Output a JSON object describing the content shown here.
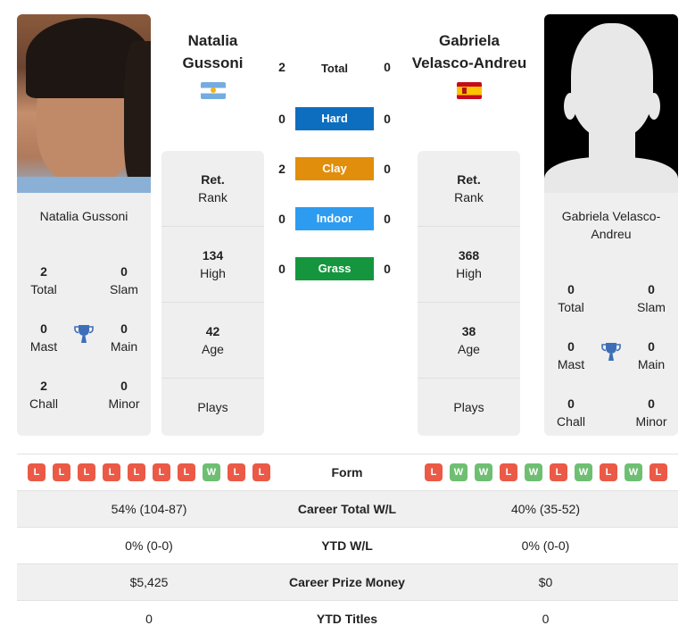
{
  "player1": {
    "name_line1": "Natalia",
    "name_line2": "Gussoni",
    "card_name": "Natalia Gussoni",
    "flag": "argentina-flag",
    "titles": {
      "total": {
        "value": "2",
        "label": "Total"
      },
      "slam": {
        "value": "0",
        "label": "Slam"
      },
      "mast": {
        "value": "0",
        "label": "Mast"
      },
      "main": {
        "value": "0",
        "label": "Main"
      },
      "chall": {
        "value": "2",
        "label": "Chall"
      },
      "minor": {
        "value": "0",
        "label": "Minor"
      }
    },
    "rank": {
      "current": {
        "value": "Ret.",
        "label": "Rank"
      },
      "high": {
        "value": "134",
        "label": "High"
      },
      "age": {
        "value": "42",
        "label": "Age"
      },
      "plays": {
        "label": "Plays"
      }
    },
    "form": [
      "L",
      "L",
      "L",
      "L",
      "L",
      "L",
      "L",
      "W",
      "L",
      "L"
    ],
    "career_wl": "54% (104-87)",
    "ytd_wl": "0% (0-0)",
    "prize_money": "$5,425",
    "ytd_titles": "0"
  },
  "player2": {
    "name_line1": "Gabriela",
    "name_line2": "Velasco-Andreu",
    "card_name_line1": "Gabriela Velasco-",
    "card_name_line2": "Andreu",
    "flag": "spain-flag",
    "titles": {
      "total": {
        "value": "0",
        "label": "Total"
      },
      "slam": {
        "value": "0",
        "label": "Slam"
      },
      "mast": {
        "value": "0",
        "label": "Mast"
      },
      "main": {
        "value": "0",
        "label": "Main"
      },
      "chall": {
        "value": "0",
        "label": "Chall"
      },
      "minor": {
        "value": "0",
        "label": "Minor"
      }
    },
    "rank": {
      "current": {
        "value": "Ret.",
        "label": "Rank"
      },
      "high": {
        "value": "368",
        "label": "High"
      },
      "age": {
        "value": "38",
        "label": "Age"
      },
      "plays": {
        "label": "Plays"
      }
    },
    "form": [
      "L",
      "W",
      "W",
      "L",
      "W",
      "L",
      "W",
      "L",
      "W",
      "L"
    ],
    "career_wl": "40% (35-52)",
    "ytd_wl": "0% (0-0)",
    "prize_money": "$0",
    "ytd_titles": "0"
  },
  "h2h": {
    "total": {
      "label": "Total",
      "p1": "2",
      "p2": "0"
    },
    "surfaces": [
      {
        "label": "Hard",
        "p1": "0",
        "p2": "0",
        "color": "#0d6ebf"
      },
      {
        "label": "Clay",
        "p1": "2",
        "p2": "0",
        "color": "#e08e0b"
      },
      {
        "label": "Indoor",
        "p1": "0",
        "p2": "0",
        "color": "#2d9cf0"
      },
      {
        "label": "Grass",
        "p1": "0",
        "p2": "0",
        "color": "#15963e"
      }
    ]
  },
  "table": {
    "form_label": "Form",
    "career_wl_label": "Career Total W/L",
    "ytd_wl_label": "YTD W/L",
    "prize_label": "Career Prize Money",
    "ytd_titles_label": "YTD Titles"
  },
  "colors": {
    "loss": "#eb5a47",
    "win": "#6fbf73",
    "trophy": "#3d6fb8",
    "card_bg": "#efefef"
  }
}
